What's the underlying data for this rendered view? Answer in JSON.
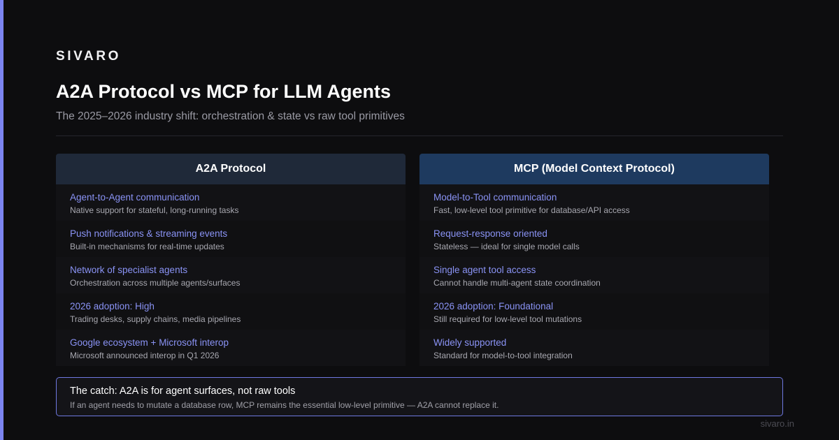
{
  "brand": "SIVARO",
  "title": "A2A Protocol vs MCP for LLM Agents",
  "subtitle": "The 2025–2026 industry shift: orchestration & state vs raw tool primitives",
  "colors": {
    "background": "#0d0d0f",
    "accent": "#7b84f0",
    "left_header": "#1f2939",
    "right_header": "#1e3a5f",
    "item_title": "#8a93f5"
  },
  "left": {
    "header": "A2A Protocol",
    "items": [
      {
        "title": "Agent-to-Agent communication",
        "desc": "Native support for stateful, long-running tasks"
      },
      {
        "title": "Push notifications & streaming events",
        "desc": "Built-in mechanisms for real-time updates"
      },
      {
        "title": "Network of specialist agents",
        "desc": "Orchestration across multiple agents/surfaces"
      },
      {
        "title": "2026 adoption: High",
        "desc": "Trading desks, supply chains, media pipelines"
      },
      {
        "title": "Google ecosystem + Microsoft interop",
        "desc": "Microsoft announced interop in Q1 2026"
      }
    ]
  },
  "right": {
    "header": "MCP (Model Context Protocol)",
    "items": [
      {
        "title": "Model-to-Tool communication",
        "desc": "Fast, low-level tool primitive for database/API access"
      },
      {
        "title": "Request-response oriented",
        "desc": "Stateless — ideal for single model calls"
      },
      {
        "title": "Single agent tool access",
        "desc": "Cannot handle multi-agent state coordination"
      },
      {
        "title": "2026 adoption: Foundational",
        "desc": "Still required for low-level tool mutations"
      },
      {
        "title": "Widely supported",
        "desc": "Standard for model-to-tool integration"
      }
    ]
  },
  "callout": {
    "title": "The catch: A2A is for agent surfaces, not raw tools",
    "body": "If an agent needs to mutate a database row, MCP remains the essential low-level primitive — A2A cannot replace it."
  },
  "footer": "sivaro.in"
}
